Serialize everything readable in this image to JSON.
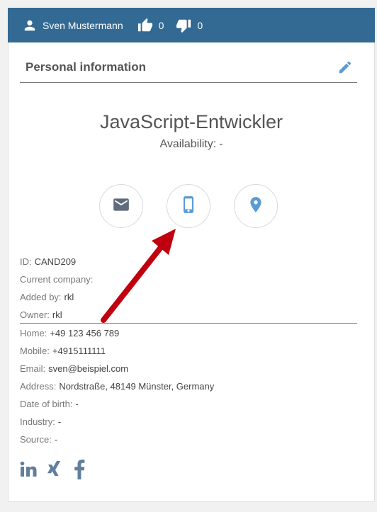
{
  "header": {
    "user_name": "Sven Mustermann",
    "likes": "0",
    "dislikes": "0",
    "bg_color": "#336a94"
  },
  "section": {
    "title": "Personal information"
  },
  "profile": {
    "job_title": "JavaScript-Entwickler",
    "availability_label": "Availability:",
    "availability_value": "-"
  },
  "contact_buttons": [
    "mail-icon",
    "phone-icon",
    "location-icon"
  ],
  "info": {
    "id_label": "ID:",
    "id_value": "CAND209",
    "company_label": "Current company:",
    "company_value": "",
    "added_label": "Added by:",
    "added_value": "rkl",
    "owner_label": "Owner:",
    "owner_value": "rkl",
    "home_label": "Home:",
    "home_value": "+49 123 456 789",
    "mobile_label": "Mobile:",
    "mobile_value": "+4915111111",
    "email_label": "Email:",
    "email_value": "sven@beispiel.com",
    "address_label": "Address:",
    "address_value": "Nordstraße, 48149 Münster, Germany",
    "dob_label": "Date of birth:",
    "dob_value": "-",
    "industry_label": "Industry:",
    "industry_value": "-",
    "source_label": "Source:",
    "source_value": "-"
  },
  "social": [
    "linkedin-icon",
    "xing-icon",
    "facebook-icon"
  ],
  "colors": {
    "accent": "#5b9bd5",
    "icon_grey": "#5f6c7b",
    "annotation_arrow": "#c0000f"
  }
}
